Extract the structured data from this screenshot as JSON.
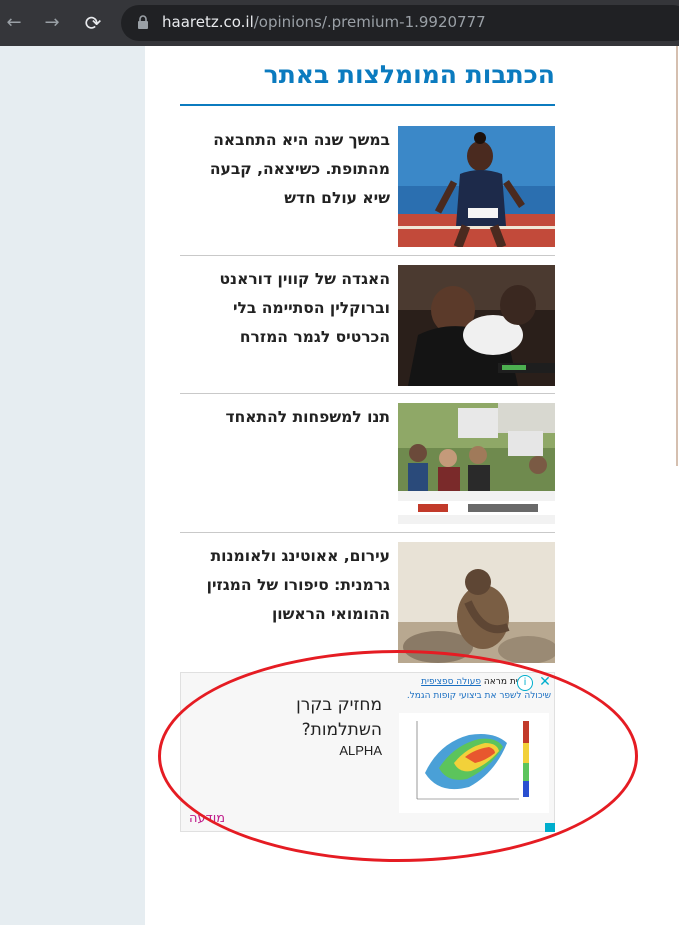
{
  "browser": {
    "back_icon": "arrow-left-icon",
    "forward_icon": "arrow-right-icon",
    "reload_icon": "reload-icon",
    "url_host": "haaretz.co.il",
    "url_path": "/opinions/.premium-1.9920777"
  },
  "section": {
    "title": "הכתבות המומלצות באתר",
    "accent_color": "#0b7bbf"
  },
  "articles": [
    {
      "title": "במשך שנה היא התחבאה מהתופת. כשיצאה, קבעה שיא עולם חדש",
      "image": "runner-photo"
    },
    {
      "title": "האגדה של קווין דוראנט וברוקלין הסתיימה בלי הכרטיס לגמר המזרח",
      "image": "basketball-photo"
    },
    {
      "title": "תנו למשפחות להתאחד",
      "image": "protest-photo"
    },
    {
      "title": "עירום, אאוטינג ולאומנות גרמנית: סיפורו של המגזין ההומואי הראשון",
      "image": "sepia-nude-photo"
    }
  ],
  "ad": {
    "headline": "מחזיק בקרן השתלמות?",
    "brand": "ALPHA",
    "label": "מודעה",
    "top_line1_prefix": "חודית מראה ",
    "top_line1_link": "פעולה ספציפית",
    "top_line2": "שיכולה לשפר את ביצועי קופות הגמל.",
    "info_icon": "info-icon",
    "close_icon": "close-icon",
    "label_color": "#c01d8c"
  }
}
